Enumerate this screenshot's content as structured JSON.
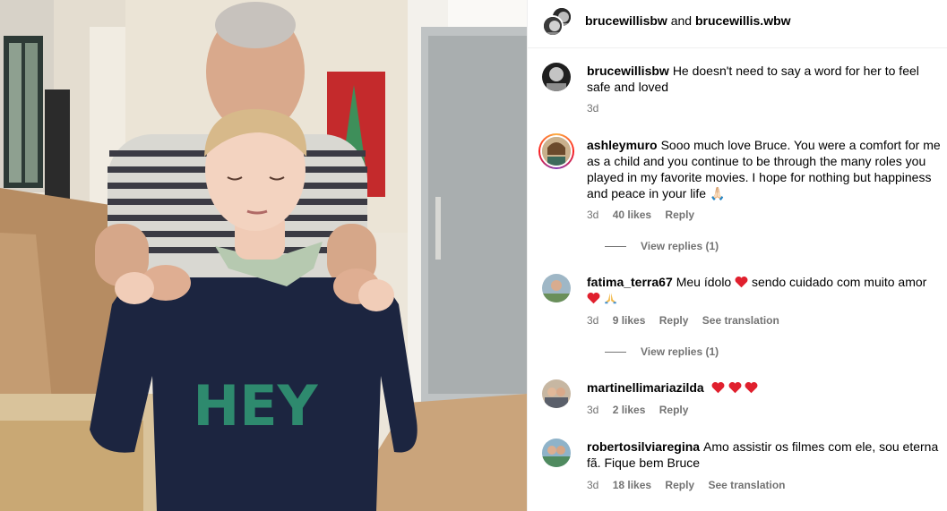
{
  "header": {
    "user1": "brucewillisbw",
    "conjunction": "and",
    "user2": "brucewillis.wbw"
  },
  "photo": {
    "sweater_text": "HEY"
  },
  "comments": [
    {
      "username": "brucewillisbw",
      "text": "He doesn't need to say a word for her to feel safe and loved",
      "time": "3d"
    },
    {
      "username": "ashleymuro",
      "text": "Sooo much love Bruce. You were a comfort for me as a child and you continue to be through the many roles you played in my favorite movies. I hope for nothing but happiness and peace in your life 🙏🏻",
      "time": "3d",
      "likes": "40 likes",
      "reply": "Reply",
      "view_replies": "View replies (1)"
    },
    {
      "username": "fatima_terra67",
      "text_before": "Meu ídolo",
      "text_after": "sendo cuidado com muito amor",
      "time": "3d",
      "likes": "9 likes",
      "reply": "Reply",
      "translate": "See translation",
      "view_replies": "View replies (1)"
    },
    {
      "username": "martinellimariazilda",
      "time": "3d",
      "likes": "2 likes",
      "reply": "Reply"
    },
    {
      "username": "robertosilviaregina",
      "text": "Amo assistir os filmes com ele, sou eterna fã. Fique bem Bruce",
      "time": "3d",
      "likes": "18 likes",
      "reply": "Reply",
      "translate": "See translation"
    }
  ],
  "colors": {
    "heart": "#ed4956",
    "meta": "#737373",
    "sweater": "#1c2540",
    "sweater_text": "#2e8a6e"
  }
}
